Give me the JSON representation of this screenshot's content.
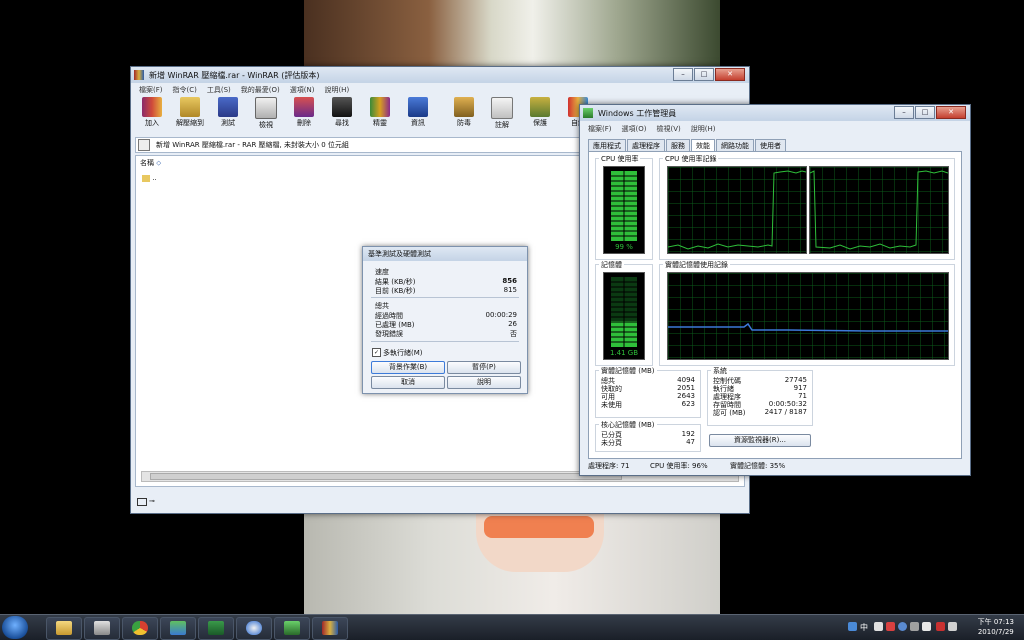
{
  "winrar": {
    "title": "新增 WinRAR 壓縮檔.rar - WinRAR (評估版本)",
    "menu": [
      "檔案(F)",
      "指令(C)",
      "工具(S)",
      "我的最愛(O)",
      "選項(N)",
      "說明(H)"
    ],
    "toolbar": [
      "加入",
      "解壓縮到",
      "測試",
      "檢視",
      "刪除",
      "尋找",
      "精靈",
      "資訊",
      "防毒",
      "註解",
      "保護",
      "自解"
    ],
    "address": "新增 WinRAR 壓縮檔.rar - RAR 壓縮檔, 未封裝大小 0 位元組",
    "list_header": "名稱",
    "list_row": ".."
  },
  "bench": {
    "title": "基準測試及硬體測試",
    "speed_heading": "速度",
    "result_label": "結果 (KB/秒)",
    "result_value": "856",
    "current_label": "目前 (KB/秒)",
    "current_value": "815",
    "total_heading": "總共",
    "elapsed_label": "經過時間",
    "elapsed_value": "00:00:29",
    "processed_label": "已處理 (MB)",
    "processed_value": "26",
    "errors_label": "發現錯誤",
    "errors_value": "否",
    "multithread_label": "多執行緒(M)",
    "multithread_checked": "✓",
    "btn_background": "背景作業(B)",
    "btn_pause": "暫停(P)",
    "btn_cancel": "取消",
    "btn_help": "說明"
  },
  "taskmgr": {
    "title": "Windows 工作管理員",
    "menu": [
      "檔案(F)",
      "選項(O)",
      "檢視(V)",
      "說明(H)"
    ],
    "tabs": [
      "應用程式",
      "處理程序",
      "服務",
      "效能",
      "網路功能",
      "使用者"
    ],
    "active_tab": "效能",
    "cpu_usage_label": "CPU 使用率",
    "cpu_usage_value": "99 %",
    "cpu_history_label": "CPU 使用率記錄",
    "memory_label": "記憶體",
    "memory_value": "1.41 GB",
    "mem_history_label": "實體記憶體使用記錄",
    "physical_mem": {
      "heading": "實體記憶體 (MB)",
      "rows": [
        [
          "總共",
          "4094"
        ],
        [
          "快取的",
          "2051"
        ],
        [
          "可用",
          "2643"
        ],
        [
          "未使用",
          "623"
        ]
      ]
    },
    "kernel_mem": {
      "heading": "核心記憶體 (MB)",
      "rows": [
        [
          "已分頁",
          "192"
        ],
        [
          "未分頁",
          "47"
        ]
      ]
    },
    "system": {
      "heading": "系統",
      "rows": [
        [
          "控制代碼",
          "27745"
        ],
        [
          "執行緒",
          "917"
        ],
        [
          "處理程序",
          "71"
        ],
        [
          "存留時間",
          "0:00:50:32"
        ],
        [
          "認可 (MB)",
          "2417 / 8187"
        ]
      ]
    },
    "resource_monitor_button": "資源監視器(R)...",
    "status": {
      "processes": "處理程序: 71",
      "cpu": "CPU 使用率: 96%",
      "memory": "實體記憶體: 35%"
    }
  },
  "taskbar": {
    "clock_time": "下午 07:13",
    "clock_date": "2010/7/29",
    "lang": "中"
  },
  "colors": {
    "graph_green": "#2fbf3a",
    "graph_grid": "#0b5a1a",
    "mem_line": "#3c78d8"
  }
}
